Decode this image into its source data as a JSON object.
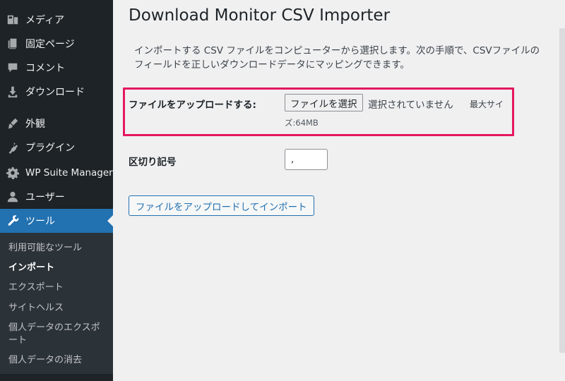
{
  "sidebar": {
    "items": [
      {
        "label": "メディア",
        "icon": "media-icon"
      },
      {
        "label": "固定ページ",
        "icon": "pages-icon"
      },
      {
        "label": "コメント",
        "icon": "comments-icon"
      },
      {
        "label": "ダウンロード",
        "icon": "download-icon"
      },
      {
        "label": "外観",
        "icon": "appearance-brush-icon"
      },
      {
        "label": "プラグイン",
        "icon": "plugins-icon"
      },
      {
        "label": "WP Suite Manager",
        "icon": "gear-icon"
      },
      {
        "label": "ユーザー",
        "icon": "users-icon"
      },
      {
        "label": "ツール",
        "icon": "wrench-icon",
        "active": true
      }
    ],
    "submenu": [
      {
        "label": "利用可能なツール"
      },
      {
        "label": "インポート",
        "current": true
      },
      {
        "label": "エクスポート"
      },
      {
        "label": "サイトヘルス"
      },
      {
        "label": "個人データのエクスポート"
      },
      {
        "label": "個人データの消去"
      }
    ]
  },
  "main": {
    "title": "Download Monitor CSV Importer",
    "description": "インポートする CSV ファイルをコンピューターから選択します。次の手順で、CSVファイルのフィールドを正しいダウンロードデータにマッピングできます。",
    "file_row": {
      "label": "ファイルをアップロードする:",
      "button_label": "ファイルを選択",
      "status": "選択されていません",
      "max_size_part1": "最大サイ",
      "max_size_part2": "ズ:64MB"
    },
    "delimiter_row": {
      "label": "区切り記号",
      "value": ","
    },
    "submit_label": "ファイルをアップロードしてインポート"
  },
  "colors": {
    "sidebar_bg": "#1d2327",
    "active_menu": "#2271b1",
    "highlight_border": "#e5175f",
    "page_bg": "#f0f0f1"
  }
}
